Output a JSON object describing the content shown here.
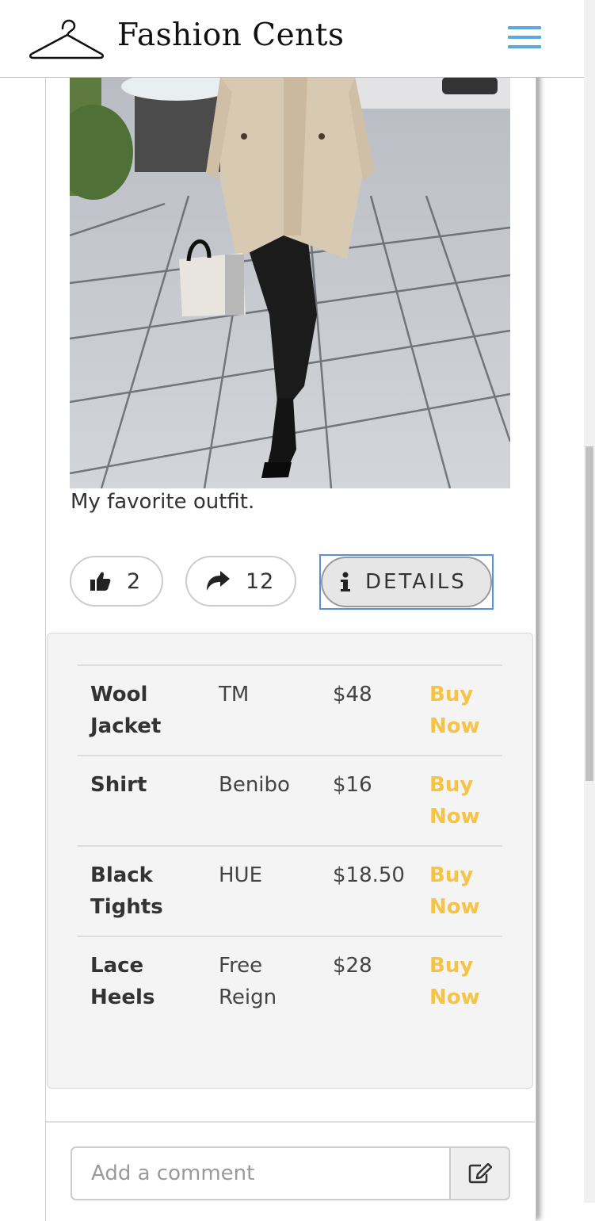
{
  "header": {
    "brand": "Fashion Cents"
  },
  "post": {
    "caption": "My favorite outfit.",
    "likes": "2",
    "shares": "12",
    "details_label": "DETAILS"
  },
  "details": {
    "items": [
      {
        "name": "Wool Jacket",
        "brand": "TM",
        "price": "$48",
        "action": "Buy Now"
      },
      {
        "name": "Shirt",
        "brand": "Benibo",
        "price": "$16",
        "action": "Buy Now"
      },
      {
        "name": "Black Tights",
        "brand": "HUE",
        "price": "$18.50",
        "action": "Buy Now"
      },
      {
        "name": "Lace Heels",
        "brand": "Free Reign",
        "price": "$28",
        "action": "Buy Now"
      }
    ]
  },
  "comment": {
    "placeholder": "Add a comment"
  },
  "icons": {
    "logo": "hanger-icon",
    "menu": "hamburger-menu-icon",
    "like": "thumbs-up-icon",
    "share": "share-arrow-icon",
    "details": "info-icon",
    "comment_submit": "pencil-square-icon"
  },
  "colors": {
    "menu_accent": "#5aa8dc",
    "buy_link": "#f5c345",
    "focus_ring": "#5b8fd6",
    "panel_bg": "#f4f4f4"
  }
}
